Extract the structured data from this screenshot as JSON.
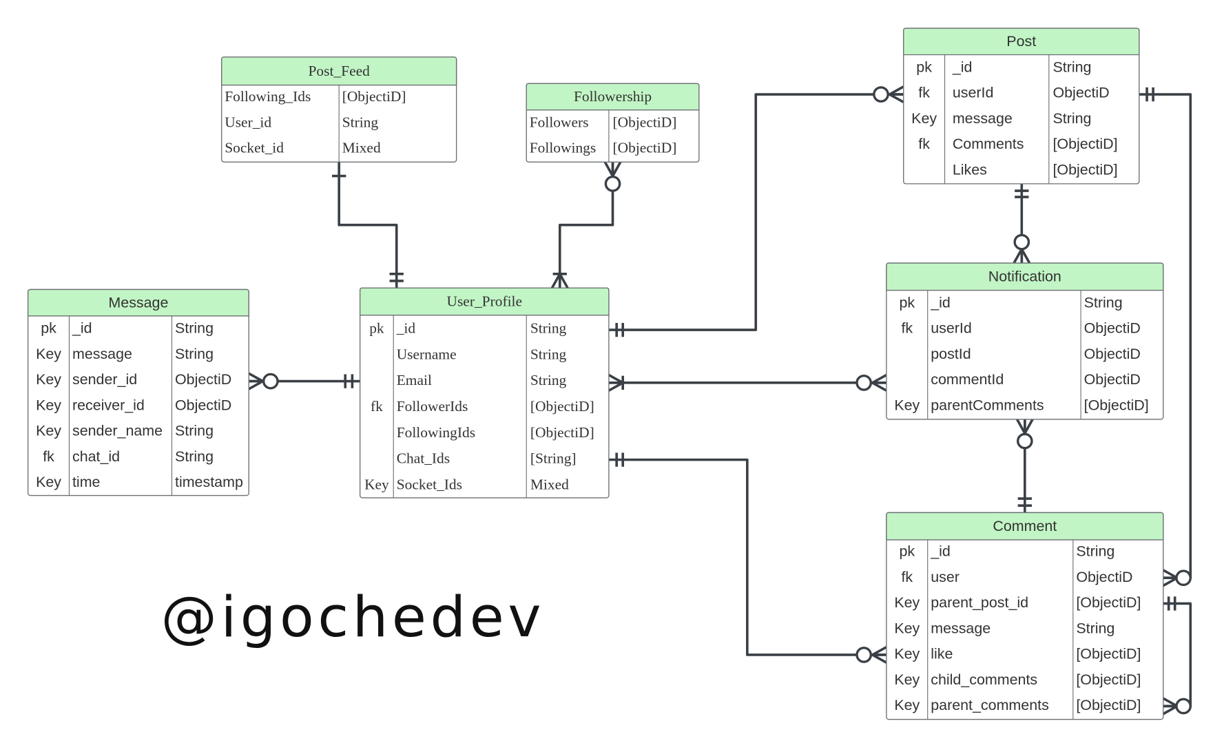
{
  "watermark": "@igochedev",
  "colors": {
    "header": "#c2f5c5",
    "line": "#3a4046"
  },
  "tables": [
    {
      "name": "Post_Feed",
      "font": "serif",
      "rows": [
        {
          "key": "",
          "field": "Following_Ids",
          "type": "[ObjectiD]"
        },
        {
          "key": "",
          "field": "User_id",
          "type": "String"
        },
        {
          "key": "",
          "field": "Socket_id",
          "type": "Mixed"
        }
      ]
    },
    {
      "name": "Followership",
      "font": "serif",
      "rows": [
        {
          "key": "",
          "field": "Followers",
          "type": "[ObjectiD]"
        },
        {
          "key": "",
          "field": "Followings",
          "type": "[ObjectiD]"
        }
      ]
    },
    {
      "name": "Post",
      "font": "sans",
      "rows": [
        {
          "key": "pk",
          "field": "_id",
          "type": "String"
        },
        {
          "key": "fk",
          "field": "userId",
          "type": "ObjectiD"
        },
        {
          "key": "Key",
          "field": "message",
          "type": "String"
        },
        {
          "key": "fk",
          "field": "Comments",
          "type": "[ObjectiD]"
        },
        {
          "key": "",
          "field": "Likes",
          "type": "[ObjectiD]"
        }
      ]
    },
    {
      "name": "Message",
      "font": "sans",
      "rows": [
        {
          "key": "pk",
          "field": "_id",
          "type": "String"
        },
        {
          "key": "Key",
          "field": "message",
          "type": "String"
        },
        {
          "key": "Key",
          "field": "sender_id",
          "type": "ObjectiD"
        },
        {
          "key": "Key",
          "field": "receiver_id",
          "type": "ObjectiD"
        },
        {
          "key": "Key",
          "field": "sender_name",
          "type": "String"
        },
        {
          "key": "fk",
          "field": "chat_id",
          "type": "String"
        },
        {
          "key": "Key",
          "field": "time",
          "type": "timestamp"
        }
      ]
    },
    {
      "name": "User_Profile",
      "font": "serif",
      "rows": [
        {
          "key": "pk",
          "field": "_id",
          "type": "String"
        },
        {
          "key": "",
          "field": "Username",
          "type": "String"
        },
        {
          "key": "",
          "field": "Email",
          "type": "String"
        },
        {
          "key": "fk",
          "field": "FollowerIds",
          "type": "[ObjectiD]"
        },
        {
          "key": "",
          "field": "FollowingIds",
          "type": "[ObjectiD]"
        },
        {
          "key": "",
          "field": "Chat_Ids",
          "type": "[String]"
        },
        {
          "key": "Key",
          "field": "Socket_Ids",
          "type": "Mixed"
        }
      ]
    },
    {
      "name": "Notification",
      "font": "sans",
      "rows": [
        {
          "key": "pk",
          "field": "_id",
          "type": "String"
        },
        {
          "key": "fk",
          "field": "userId",
          "type": "ObjectiD"
        },
        {
          "key": "",
          "field": "postId",
          "type": "ObjectiD"
        },
        {
          "key": "",
          "field": "commentId",
          "type": "ObjectiD"
        },
        {
          "key": "Key",
          "field": "parentComments",
          "type": "[ObjectiD]"
        }
      ]
    },
    {
      "name": "Comment",
      "font": "sans",
      "rows": [
        {
          "key": "pk",
          "field": "_id",
          "type": "String"
        },
        {
          "key": "fk",
          "field": "user",
          "type": "ObjectiD"
        },
        {
          "key": "Key",
          "field": "parent_post_id",
          "type": "[ObjectiD]"
        },
        {
          "key": "Key",
          "field": "message",
          "type": "String"
        },
        {
          "key": "Key",
          "field": "like",
          "type": "[ObjectiD]"
        },
        {
          "key": "Key",
          "field": "child_comments",
          "type": "[ObjectiD]"
        },
        {
          "key": "Key",
          "field": "parent_comments",
          "type": "[ObjectiD]"
        }
      ]
    }
  ]
}
